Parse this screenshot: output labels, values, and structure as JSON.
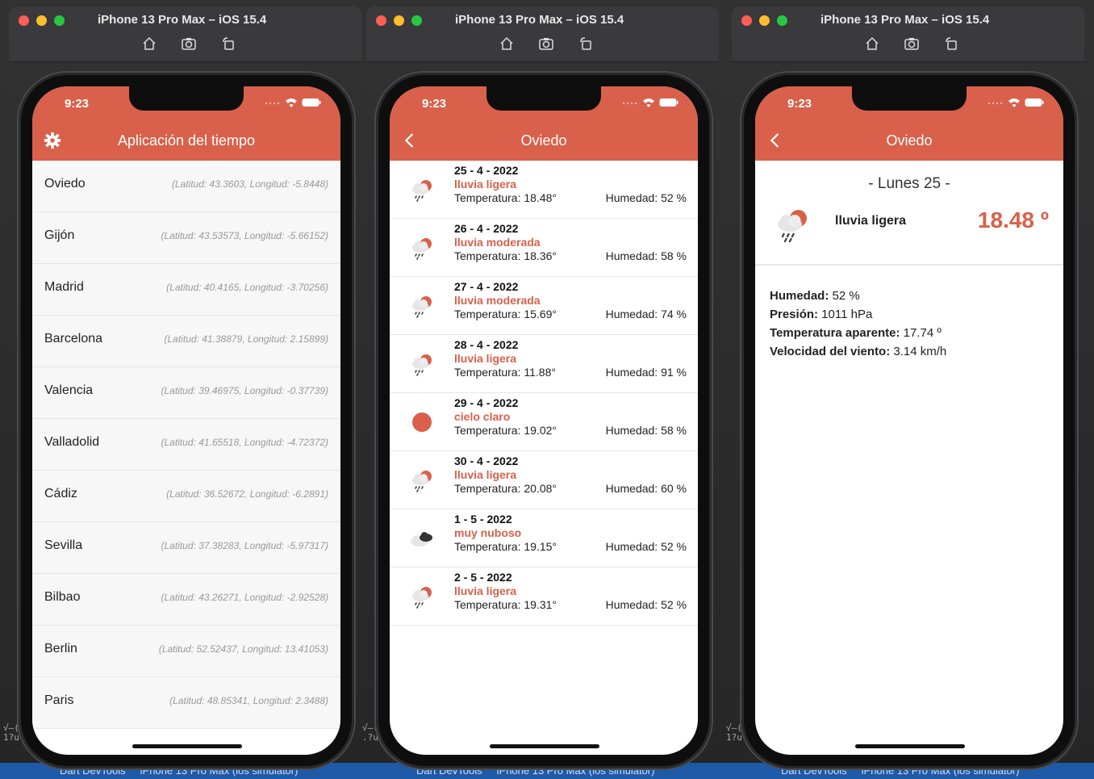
{
  "window_title": "iPhone 13 Pro Max – iOS 15.4",
  "status_time": "9:23",
  "taskbar": {
    "items": [
      "Dart DevTools",
      "iPhone 13 Pro Max (ios simulator)"
    ]
  },
  "colors": {
    "accent": "#d9604a"
  },
  "screen1": {
    "title": "Aplicación del tiempo",
    "settings_icon": "gear-icon",
    "cities": [
      {
        "name": "Oviedo",
        "coords": "(Latitud: 43.3603, Longitud: -5.8448)"
      },
      {
        "name": "Gijón",
        "coords": "(Latitud: 43.53573, Longitud: -5.66152)"
      },
      {
        "name": "Madrid",
        "coords": "(Latitud: 40.4165, Longitud: -3.70256)"
      },
      {
        "name": "Barcelona",
        "coords": "(Latitud: 41.38879, Longitud: 2.15899)"
      },
      {
        "name": "Valencia",
        "coords": "(Latitud: 39.46975, Longitud: -0.37739)"
      },
      {
        "name": "Valladolid",
        "coords": "(Latitud: 41.65518, Longitud: -4.72372)"
      },
      {
        "name": "Cádiz",
        "coords": "(Latitud: 36.52672, Longitud: -6.2891)"
      },
      {
        "name": "Sevilla",
        "coords": "(Latitud: 37.38283, Longitud: -5.97317)"
      },
      {
        "name": "Bilbao",
        "coords": "(Latitud: 43.26271, Longitud: -2.92528)"
      },
      {
        "name": "Berlin",
        "coords": "(Latitud: 52.52437, Longitud: 13.41053)"
      },
      {
        "name": "Paris",
        "coords": "(Latitud: 48.85341, Longitud: 2.3488)"
      }
    ]
  },
  "screen2": {
    "title": "Oviedo",
    "forecast": [
      {
        "date": "25 - 4 - 2022",
        "desc": "lluvia ligera",
        "temp": "Temperatura: 18.48°",
        "hum": "Humedad: 52 %",
        "icon": "rain"
      },
      {
        "date": "26 - 4 - 2022",
        "desc": "lluvia moderada",
        "temp": "Temperatura: 18.36°",
        "hum": "Humedad: 58 %",
        "icon": "rain"
      },
      {
        "date": "27 - 4 - 2022",
        "desc": "lluvia moderada",
        "temp": "Temperatura: 15.69°",
        "hum": "Humedad: 74 %",
        "icon": "rain"
      },
      {
        "date": "28 - 4 - 2022",
        "desc": "lluvia ligera",
        "temp": "Temperatura: 11.88°",
        "hum": "Humedad: 91 %",
        "icon": "rain"
      },
      {
        "date": "29 - 4 - 2022",
        "desc": "cielo claro",
        "temp": "Temperatura: 19.02°",
        "hum": "Humedad: 58 %",
        "icon": "sun"
      },
      {
        "date": "30 - 4 - 2022",
        "desc": "lluvia ligera",
        "temp": "Temperatura: 20.08°",
        "hum": "Humedad: 60 %",
        "icon": "rain"
      },
      {
        "date": "1 - 5 - 2022",
        "desc": "muy nuboso",
        "temp": "Temperatura: 19.15°",
        "hum": "Humedad: 52 %",
        "icon": "clouds"
      },
      {
        "date": "2 - 5 - 2022",
        "desc": "lluvia ligera",
        "temp": "Temperatura: 19.31°",
        "hum": "Humedad: 52 %",
        "icon": "rain"
      }
    ]
  },
  "screen3": {
    "title": "Oviedo",
    "day": "- Lunes  25 -",
    "desc": "lluvia ligera",
    "temp": "18.48 º",
    "props": [
      {
        "label": "Humedad:",
        "value": " 52 %"
      },
      {
        "label": "Presión:",
        "value": " 1011 hPa"
      },
      {
        "label": "Temperatura aparente:",
        "value": " 17.74 º"
      },
      {
        "label": "Velocidad del viento:",
        "value": " 3.14 km/h"
      }
    ]
  }
}
